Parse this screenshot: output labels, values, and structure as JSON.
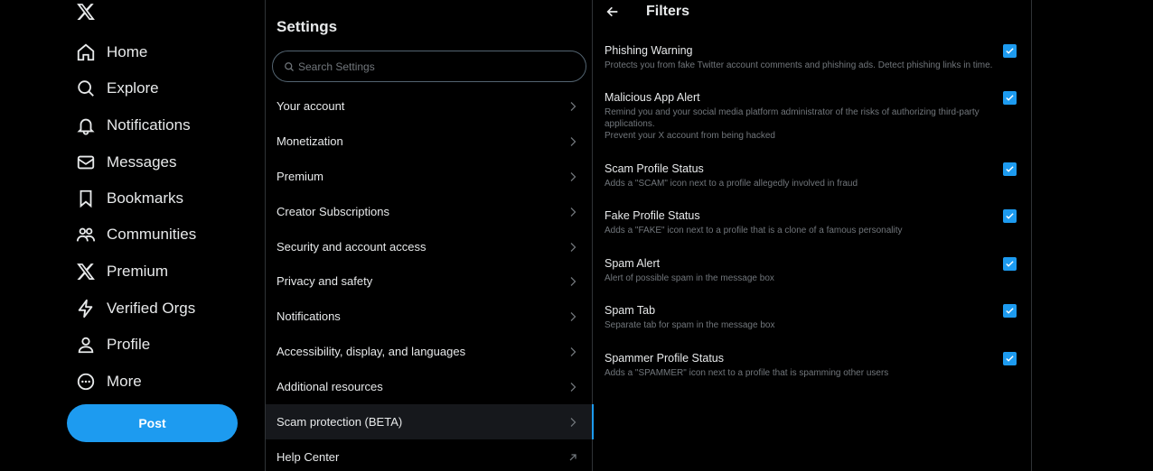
{
  "nav": {
    "logo_icon": "x-logo-icon",
    "items": [
      {
        "label": "Home",
        "icon": "home-icon"
      },
      {
        "label": "Explore",
        "icon": "search-icon"
      },
      {
        "label": "Notifications",
        "icon": "bell-icon"
      },
      {
        "label": "Messages",
        "icon": "envelope-icon"
      },
      {
        "label": "Bookmarks",
        "icon": "bookmark-icon"
      },
      {
        "label": "Communities",
        "icon": "people-icon"
      },
      {
        "label": "Premium",
        "icon": "x-logo-icon"
      },
      {
        "label": "Verified Orgs",
        "icon": "lightning-icon"
      },
      {
        "label": "Profile",
        "icon": "person-icon"
      },
      {
        "label": "More",
        "icon": "more-icon"
      }
    ],
    "post_label": "Post"
  },
  "settings": {
    "title": "Settings",
    "search_placeholder": "Search Settings",
    "items": [
      {
        "label": "Your account",
        "icon": "chevron-right-icon"
      },
      {
        "label": "Monetization",
        "icon": "chevron-right-icon"
      },
      {
        "label": "Premium",
        "icon": "chevron-right-icon"
      },
      {
        "label": "Creator Subscriptions",
        "icon": "chevron-right-icon"
      },
      {
        "label": "Security and account access",
        "icon": "chevron-right-icon"
      },
      {
        "label": "Privacy and safety",
        "icon": "chevron-right-icon"
      },
      {
        "label": "Notifications",
        "icon": "chevron-right-icon"
      },
      {
        "label": "Accessibility, display, and languages",
        "icon": "chevron-right-icon"
      },
      {
        "label": "Additional resources",
        "icon": "chevron-right-icon"
      },
      {
        "label": "Scam protection (BETA)",
        "icon": "chevron-right-icon",
        "active": true
      },
      {
        "label": "Help Center",
        "icon": "external-link-icon"
      }
    ]
  },
  "filters": {
    "title": "Filters",
    "items": [
      {
        "title": "Phishing Warning",
        "description": "Protects you from fake Twitter account comments and phishing ads. Detect phishing links in time.",
        "checked": true
      },
      {
        "title": "Malicious App Alert",
        "description": "Remind you and your social media platform administrator of the risks of authorizing third-party applications.",
        "description2": "Prevent your X account from being hacked",
        "checked": true
      },
      {
        "title": "Scam Profile Status",
        "description": "Adds a \"SCAM\" icon next to a profile allegedly involved in fraud",
        "checked": true
      },
      {
        "title": "Fake Profile Status",
        "description": "Adds a \"FAKE\" icon next to a profile that is a clone of a famous personality",
        "checked": true
      },
      {
        "title": "Spam Alert",
        "description": "Alert of possible spam in the message box",
        "checked": true
      },
      {
        "title": "Spam Tab",
        "description": "Separate tab for spam in the message box",
        "checked": true
      },
      {
        "title": "Spammer Profile Status",
        "description": "Adds a \"SPAMMER\" icon next to a profile that is spamming other users",
        "checked": true
      }
    ]
  },
  "colors": {
    "accent": "#1d9bf0",
    "background": "#000000",
    "text": "#e7e9ea",
    "muted": "#71767b",
    "border": "#2f3336"
  }
}
